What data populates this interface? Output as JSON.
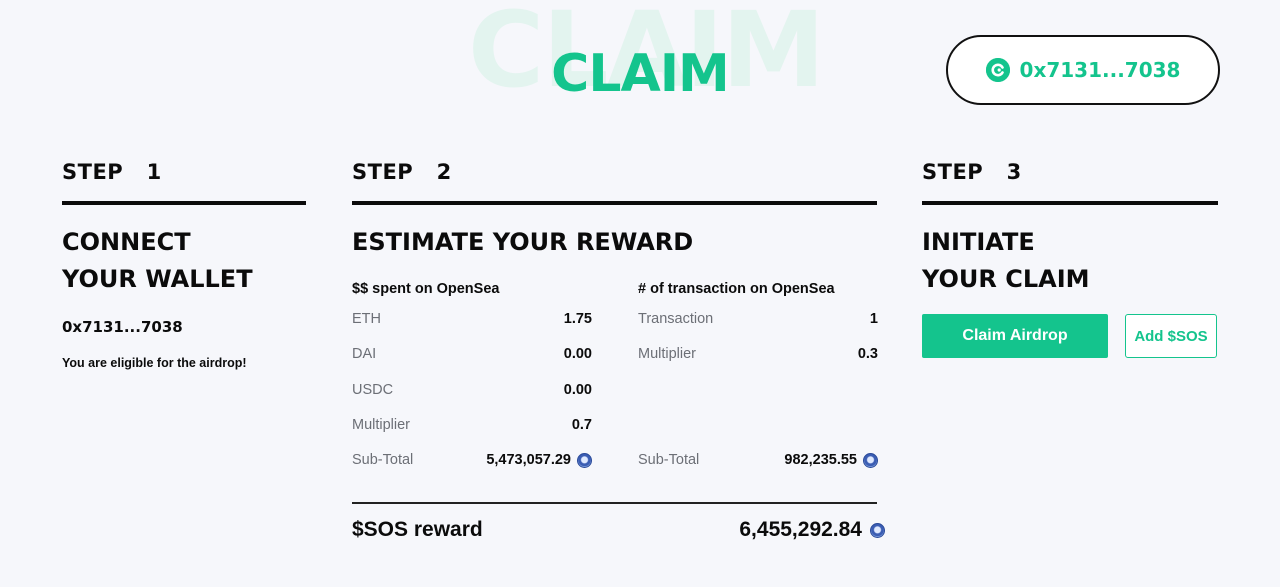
{
  "header": {
    "title_watermark": "CLAIM",
    "title": "CLAIM",
    "wallet_pill_address": "0x7131...7038"
  },
  "step1": {
    "label": "STEP   1",
    "heading_line1": "CONNECT",
    "heading_line2": "YOUR WALLET",
    "address": "0x7131...7038",
    "eligibility_text": "You are eligible for the airdrop!"
  },
  "step2": {
    "label": "STEP   2",
    "heading": "ESTIMATE YOUR REWARD",
    "spent": {
      "header": "$$ spent on OpenSea",
      "rows": [
        {
          "label": "ETH",
          "value": "1.75"
        },
        {
          "label": "DAI",
          "value": "0.00"
        },
        {
          "label": "USDC",
          "value": "0.00"
        },
        {
          "label": "Multiplier",
          "value": "0.7"
        },
        {
          "label": "Sub-Total",
          "value": "5,473,057.29"
        }
      ]
    },
    "transactions": {
      "header": "# of transaction on OpenSea",
      "rows": [
        {
          "label": "Transaction",
          "value": "1"
        },
        {
          "label": "Multiplier",
          "value": "0.3"
        },
        {
          "label": "Sub-Total",
          "value": "982,235.55"
        }
      ]
    },
    "reward_label": "$SOS reward",
    "reward_value": "6,455,292.84"
  },
  "step3": {
    "label": "STEP   3",
    "heading_line1": "INITIATE",
    "heading_line2": "YOUR CLAIM",
    "claim_button_label": "Claim Airdrop",
    "add_token_button_label": "Add $SOS"
  },
  "colors": {
    "accent": "#14c48d",
    "background": "#f6f7fb",
    "text": "#0b0b0b",
    "muted": "#6c6f76"
  },
  "icons": {
    "wallet_pill": "opensea-wallet-icon",
    "token": "sos-token-icon"
  }
}
